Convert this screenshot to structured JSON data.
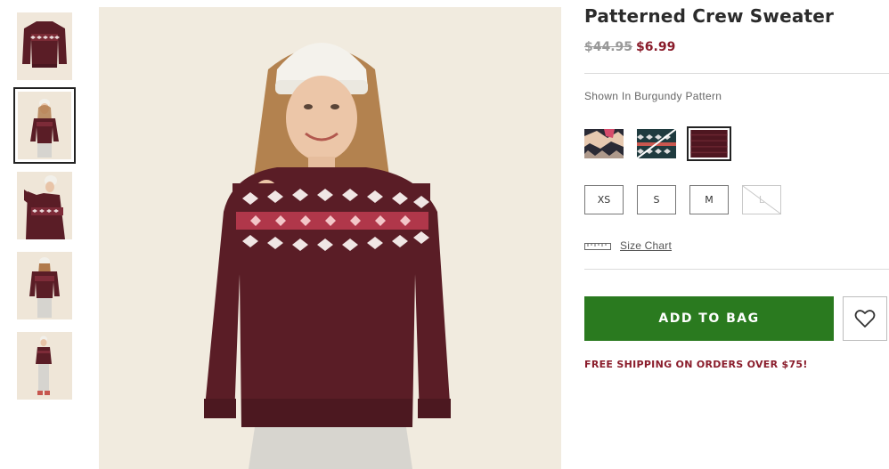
{
  "product": {
    "title": "Patterned Crew Sweater",
    "original_price": "$44.95",
    "sale_price": "$6.99",
    "shown_in": "Shown In Burgundy Pattern"
  },
  "thumbnails": [
    {
      "name": "flat-sweater",
      "selected": false
    },
    {
      "name": "model-front",
      "selected": true
    },
    {
      "name": "model-side",
      "selected": false
    },
    {
      "name": "model-back",
      "selected": false
    },
    {
      "name": "model-full",
      "selected": false
    }
  ],
  "swatches": [
    {
      "name": "pink-pattern",
      "selected": false,
      "colors": [
        "#2a2a35",
        "#e7c9b0",
        "#d64c6c"
      ]
    },
    {
      "name": "navy-pattern",
      "selected": false,
      "colors": [
        "#1f3b3f",
        "#dedede",
        "#c8574f"
      ]
    },
    {
      "name": "burgundy-pattern",
      "selected": true,
      "colors": [
        "#4e1620",
        "#6a2530"
      ]
    }
  ],
  "sizes": [
    {
      "label": "XS",
      "available": true
    },
    {
      "label": "S",
      "available": true
    },
    {
      "label": "M",
      "available": true
    },
    {
      "label": "L",
      "available": false
    }
  ],
  "size_chart_label": "Size Chart",
  "add_to_bag_label": "ADD TO BAG",
  "shipping_message": "FREE SHIPPING ON ORDERS OVER $75!",
  "colors": {
    "sale_price": "#8a1c2b",
    "add_to_bag": "#2a7a1f",
    "sweater": "#5a1d26"
  },
  "icons": {
    "wishlist": "heart-icon",
    "size_chart": "ruler-icon"
  }
}
